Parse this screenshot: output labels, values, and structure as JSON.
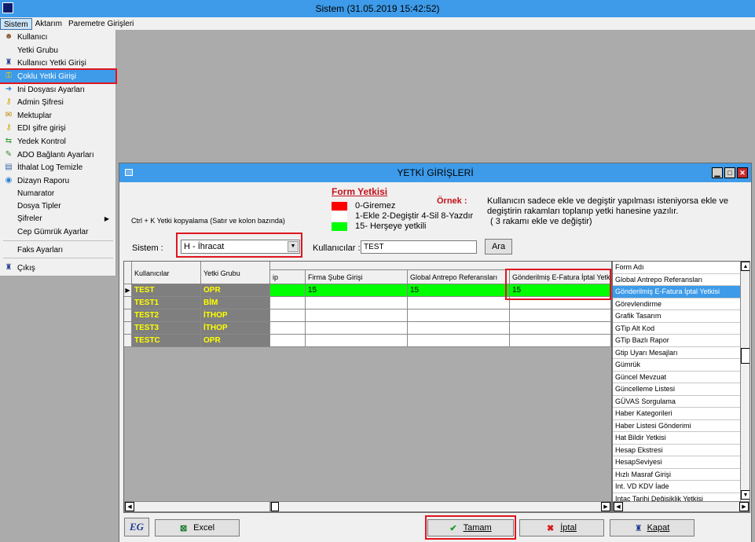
{
  "app": {
    "title": "Sistem (31.05.2019 15:42:52)"
  },
  "menubar": {
    "items": [
      {
        "label": "Sistem",
        "active": true
      },
      {
        "label": "Aktarım",
        "active": false
      },
      {
        "label": "Paremetre Girişleri",
        "active": false
      }
    ]
  },
  "sistem_menu": {
    "items": [
      {
        "label": "Kullanıcı",
        "icon": "user-icon"
      },
      {
        "label": "Yetki Grubu",
        "icon": ""
      },
      {
        "label": "Kullanıcı Yetki Girişi",
        "icon": "user-key-icon"
      },
      {
        "label": "Çoklu Yetki Girişi",
        "icon": "keys-icon",
        "selected": true
      },
      {
        "label": "Ini Dosyası  Ayarları",
        "icon": "file-arrow-icon"
      },
      {
        "label": "Admin Şifresi",
        "icon": "key-icon"
      },
      {
        "label": "Mektuplar",
        "icon": "letter-icon"
      },
      {
        "label": "EDI şifre girişi",
        "icon": "key-icon"
      },
      {
        "label": "Yedek Kontrol",
        "icon": "backup-icon"
      },
      {
        "label": "ADO Bağlantı Ayarları",
        "icon": "plug-icon"
      },
      {
        "label": "İthalat Log Temizle",
        "icon": "broom-icon"
      },
      {
        "label": "Dizayn Raporu",
        "icon": "report-icon"
      },
      {
        "label": "Numarator",
        "icon": ""
      },
      {
        "label": "Dosya Tipler",
        "icon": ""
      },
      {
        "label": "Şifreler",
        "icon": "",
        "submenu": true
      },
      {
        "label": "Cep Gümrük Ayarlar",
        "icon": ""
      },
      {
        "label": "Faks Ayarları",
        "icon": ""
      },
      {
        "label": "Çıkış",
        "icon": "exit-icon"
      }
    ]
  },
  "dialog": {
    "title": "YETKİ GİRİŞLERİ",
    "legend": {
      "title": "Form Yetkisi",
      "items": [
        {
          "label": "0-Giremez",
          "color": "#ff0000"
        },
        {
          "label": "1-Ekle  2-Degiştir  4-Sil  8-Yazdır",
          "color": "#ffffff"
        },
        {
          "label": "15- Herşeye yetkili",
          "color": "#00ff00"
        }
      ]
    },
    "example_label": "Örnek :",
    "example_text": "Kullanıcın sadece ekle ve degiştir yapılması isteniyorsa  ekle ve degiştirin rakamları toplanıp yetki hanesine yazılır.",
    "example_note": "( 3 rakamı ekle ve değiştir)",
    "ctrl_k_hint": "Ctrl + K Yetki kopyalama (Satır ve kolon bazında)",
    "sistem_label": "Sistem :",
    "sistem_value": "H - İhracat",
    "kullanicilar_label": "Kullanıcılar :",
    "kullanicilar_value": "TEST",
    "ara_button": "Ara",
    "grid": {
      "columns": [
        "Kullanıcılar",
        "Yetki Grubu",
        "ip",
        "Firma Şube Girişi",
        "Global Antrepo Referansları",
        "Gönderilmiş E-Fatura İptal Yetk"
      ],
      "rows": [
        {
          "user": "TEST",
          "group": "OPR",
          "values": [
            "",
            "15",
            "15",
            "15"
          ],
          "current": true
        },
        {
          "user": "TEST1",
          "group": "BİM",
          "values": [
            "",
            "",
            "",
            ""
          ]
        },
        {
          "user": "TEST2",
          "group": "İTHOP",
          "values": [
            "",
            "",
            "",
            ""
          ]
        },
        {
          "user": "TEST3",
          "group": "İTHOP",
          "values": [
            "",
            "",
            "",
            ""
          ]
        },
        {
          "user": "TESTC",
          "group": "OPR",
          "values": [
            "",
            "",
            "",
            ""
          ]
        }
      ]
    },
    "form_list": {
      "header": "Form Adı",
      "items": [
        "Global Antrepo Referansları",
        "Gönderilmiş E-Fatura İptal Yetkisi",
        "Görevlendirme",
        "Grafik Tasarım",
        "GTip Alt Kod",
        "GTip Bazlı Rapor",
        "Gtip Uyarı Mesajları",
        "Gümrük",
        "Güncel Mevzuat",
        "Güncelleme Listesi",
        "GÜVAS Sorgulama",
        "Haber Kategorileri",
        "Haber Listesi Gönderimi",
        "Hat Bildir Yetkisi",
        "Hesap Ekstresi",
        "HesapSeviyesi",
        "Hızlı Masraf Girişi",
        "Int. VD KDV İade",
        "Intaç Tarihi Değişiklik Yetkisi"
      ],
      "selected_index": 1
    },
    "buttons": {
      "excel": "Excel",
      "tamam": "Tamam",
      "iptal": "İptal",
      "kapat": "Kapat"
    },
    "logo_text": "EG"
  },
  "colors": {
    "titlebar": "#3d9be9",
    "highlight": "#e0151f",
    "row_user_bg": "#7f7f7f",
    "row_user_text": "#ffff00",
    "green": "#00ff00"
  }
}
